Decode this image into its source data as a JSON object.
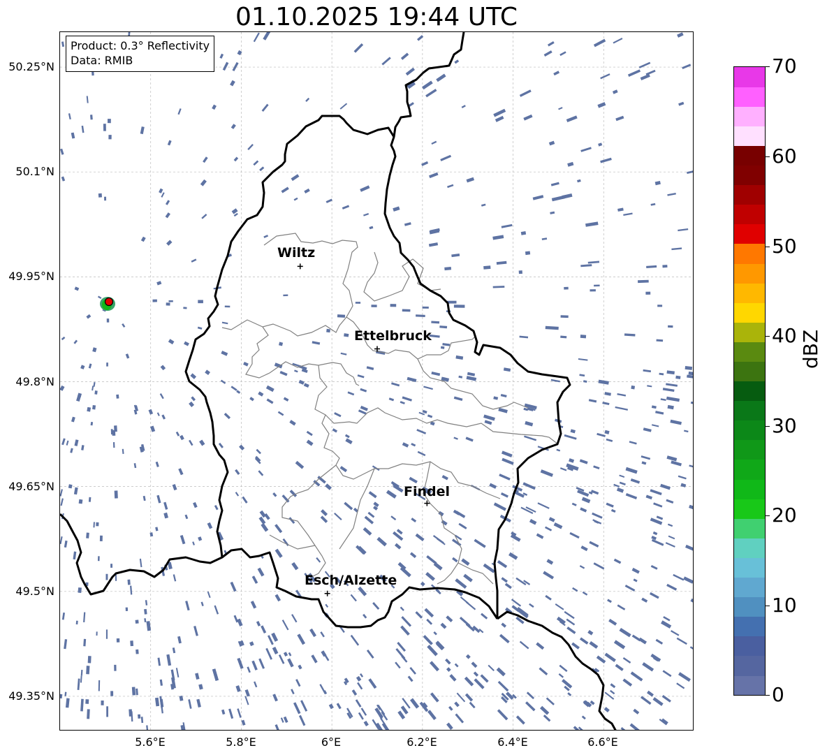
{
  "title": "01.10.2025 19:44 UTC",
  "info_box": {
    "product": "Product: 0.3° Reflectivity",
    "data": "Data: RMIB"
  },
  "latitude_labels": [
    "50.25°N",
    "50.1°N",
    "49.95°N",
    "49.8°N",
    "49.65°N",
    "49.5°N",
    "49.35°N"
  ],
  "longitude_labels": [
    "5.6°E",
    "5.8°E",
    "6°E",
    "6.2°E",
    "6.4°E",
    "6.6°E"
  ],
  "cities": [
    {
      "name": "Wiltz",
      "lon": 5.93,
      "lat": 49.965
    },
    {
      "name": "Ettelbruck",
      "lon": 6.1,
      "lat": 49.847
    },
    {
      "name": "Findel",
      "lon": 6.21,
      "lat": 49.626
    },
    {
      "name": "Esch/Alzette",
      "lon": 5.99,
      "lat": 49.497
    }
  ],
  "radar_site": {
    "lon": 5.505,
    "lat": 49.914,
    "marker_color": "#e00000"
  },
  "map_extent": {
    "lon_min": 5.4,
    "lon_max": 6.8,
    "lat_min": 49.3,
    "lat_max": 50.3
  },
  "grid": "on",
  "colorbar": {
    "unit": "dBZ",
    "min": 0,
    "max": 70,
    "tick_labels": [
      "70",
      "60",
      "50",
      "40",
      "30",
      "20",
      "10",
      "0"
    ],
    "colors": [
      "#6673a8",
      "#5566a0",
      "#4a5fa0",
      "#4470b0",
      "#5090c0",
      "#60a8d0",
      "#68c0d8",
      "#60d0c0",
      "#40d070",
      "#18c818",
      "#10b818",
      "#10a818",
      "#109818",
      "#0c8818",
      "#0a7818",
      "#065c10",
      "#3c7410",
      "#5a8a10",
      "#aab40a",
      "#ffd700",
      "#ffb800",
      "#ff9800",
      "#ff7800",
      "#e00000",
      "#c00000",
      "#a00000",
      "#800000",
      "#780000",
      "#ffe0ff",
      "#ffb0ff",
      "#ff60ff",
      "#e838e8"
    ]
  },
  "echo_color": "#5e73a3"
}
